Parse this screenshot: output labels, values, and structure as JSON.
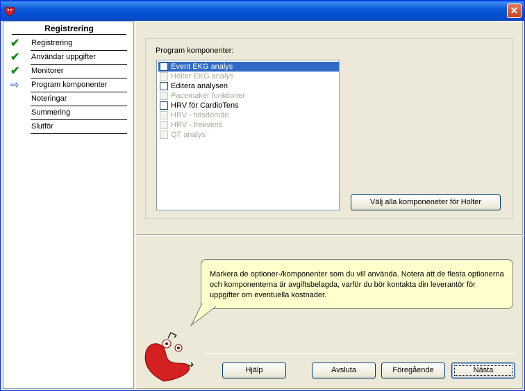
{
  "window": {
    "close_glyph": "✕",
    "icon": "heart-app-icon"
  },
  "sidebar": {
    "title": "Registrering",
    "steps": [
      {
        "label": "Registrering",
        "status": "done"
      },
      {
        "label": "Användar uppgifter",
        "status": "done"
      },
      {
        "label": "Monitorer",
        "status": "done"
      },
      {
        "label": "Program komponenter",
        "status": "current"
      },
      {
        "label": "Noteringar",
        "status": "pending"
      },
      {
        "label": "Summering",
        "status": "pending"
      },
      {
        "label": "Slutför",
        "status": "pending"
      }
    ],
    "done_glyph": "✔",
    "current_glyph": "⇨"
  },
  "components": {
    "label": "Program komponenter:",
    "items": [
      {
        "label": "Event EKG analys",
        "enabled": true,
        "checked": false,
        "selected": true
      },
      {
        "label": "Holter EKG analys",
        "enabled": false,
        "checked": false,
        "selected": false
      },
      {
        "label": "Editera analysen",
        "enabled": true,
        "checked": false,
        "selected": false
      },
      {
        "label": "Pacemaker funktioner",
        "enabled": false,
        "checked": false,
        "selected": false
      },
      {
        "label": "HRV för CardioTens",
        "enabled": true,
        "checked": false,
        "selected": false
      },
      {
        "label": "HRV - tidsdomän",
        "enabled": false,
        "checked": false,
        "selected": false
      },
      {
        "label": "HRV - frekvens",
        "enabled": false,
        "checked": false,
        "selected": false
      },
      {
        "label": "QT analys",
        "enabled": false,
        "checked": false,
        "selected": false
      }
    ],
    "select_all_label": "Välj alla komponeneter för Holter"
  },
  "help_bubble": {
    "text": "Markera de optioner-/komponenter som du vill använda. Notera att de flesta optionerna\noch komponenterna är avgiftsbelagda, varför du bör kontakta din leverantör för\nuppgifter om eventuella kostnader."
  },
  "buttons": {
    "help": "Hjälp",
    "cancel": "Avsluta",
    "previous": "Föregående",
    "next": "Nästa"
  },
  "colors": {
    "titlebar": "#0b5bd9",
    "selection": "#316ac5",
    "bubble": "#ffffcc",
    "check": "#1a8a1a",
    "mascot": "#d42020"
  }
}
